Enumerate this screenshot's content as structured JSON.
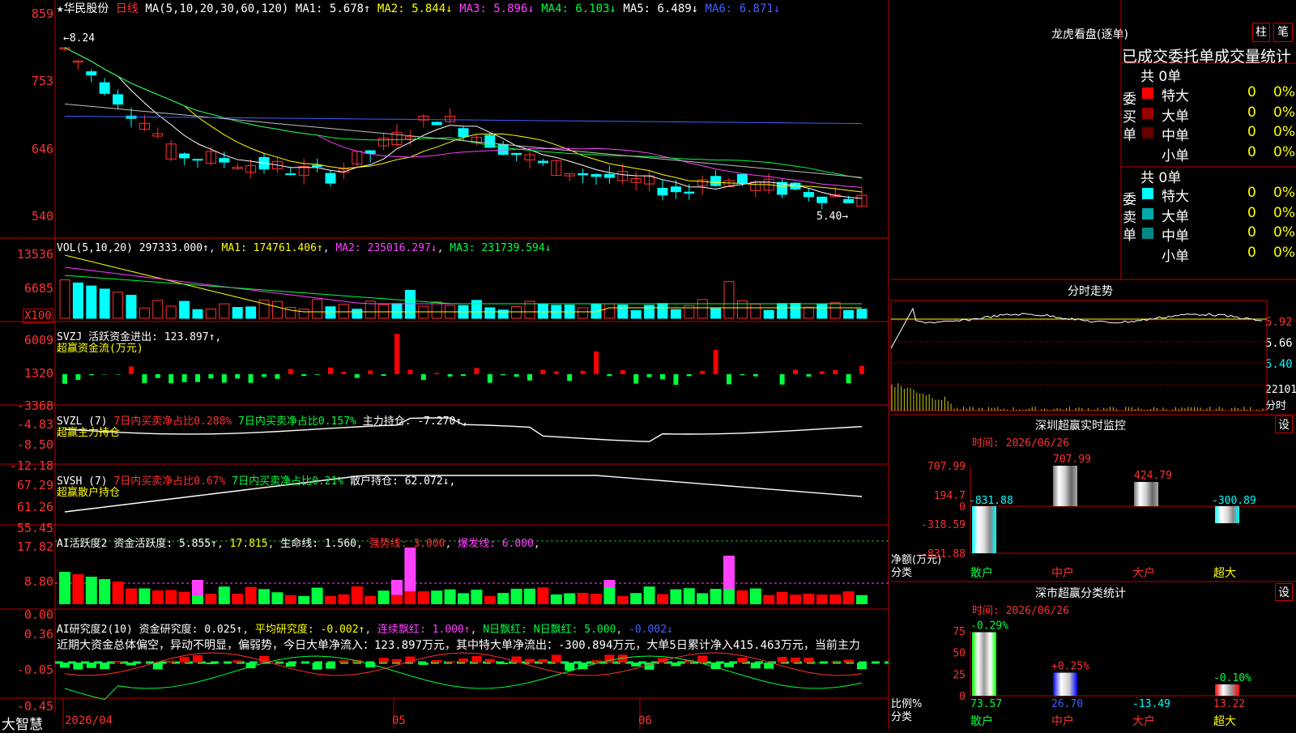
{
  "stock": {
    "name": "华民股份",
    "period": "日线",
    "ma_header": "MA(5,10,20,30,60,120)",
    "ma1": "MA1: 5.678↑",
    "ma2": "MA2: 5.844↓",
    "ma3": "MA3: 5.896↓",
    "ma4": "MA4: 6.103↓",
    "ma5": "MA5: 6.489↓",
    "ma6": "MA6: 6.871↓",
    "high_mark": "8.24",
    "low_mark": "5.40→",
    "y_ticks": [
      "859",
      "753",
      "646",
      "540"
    ]
  },
  "vol": {
    "header": "VOL(5,10,20)",
    "value": "297333.000↑",
    "ma1": "MA1: 174761.406↑",
    "ma2": "MA2: 235016.297↓",
    "ma3": "MA3: 231739.594↓",
    "y_ticks": [
      "13536",
      "6685"
    ],
    "unit": "X100"
  },
  "svzj": {
    "header": "SVZJ 活跃资金进出: 123.897↑,",
    "sub": "超赢资金流(万元)",
    "y_ticks": [
      "6009",
      "1320",
      "-3368"
    ]
  },
  "svzl": {
    "name": "SVZL (7)",
    "buy": "7日内买卖净占比0.288%",
    "buy2": "7日内买卖净占比0.157%",
    "pos": "主力持仓: -7.270↑,",
    "sub": "超赢主力持仓",
    "y_ticks": [
      "-4.83",
      "-8.50",
      "-12.18"
    ]
  },
  "svsh": {
    "name": "SVSH (7)",
    "buy": "7日内买卖净占比0.67%",
    "buy2": "7日内买卖净占比0.21%",
    "pos": "散户持仓: 62.072↓,",
    "sub": "超赢散户持仓",
    "y_ticks": [
      "67.29",
      "61.26",
      "55.45"
    ]
  },
  "ai1": {
    "name": "AI活跃度2",
    "a": "资金活跃度: 5.855↑",
    "b": "17.815",
    "c": "生命线: 1.560",
    "d": "强势线: 3.000",
    "e": "爆发线: 6.000",
    "y_ticks": [
      "17.82",
      "8.80",
      "0.00"
    ]
  },
  "ai2": {
    "name": "AI研究度2(10)",
    "a": "资金研究度: 0.025↑",
    "b": "平均研究度: -0.002↑",
    "c": "连续飘红: 1.000↑",
    "d": "N日飘红: 5.000",
    "e": "-0.002↓",
    "text": "近期大资金总体偏空，异动不明显，偏弱势，今日大单净流入：123.897万元，其中特大单净流出：-300.894万元，大单5日累计净入415.463万元，当前主力",
    "y_ticks": [
      "0.36",
      "-0.05",
      "-0.45"
    ]
  },
  "axis": {
    "d1": "2026/04",
    "d2": "05",
    "d3": "06",
    "brand": "大智慧"
  },
  "lhb": {
    "title": "龙虎看盘(逐单)",
    "btn1": "柱",
    "btn2": "笔",
    "subtitle": "已成交委托单成交量统计",
    "buy_label": "委买单",
    "sell_label": "委卖单",
    "buy_total": "共 0单",
    "sell_total": "共 0单",
    "rows": [
      {
        "name": "特大",
        "v": "0",
        "p": "0%",
        "color": "#ff0000"
      },
      {
        "name": "大单",
        "v": "0",
        "p": "0%",
        "color": "#990000"
      },
      {
        "name": "中单",
        "v": "0",
        "p": "0%",
        "color": "#660000"
      },
      {
        "name": "小单",
        "v": "0",
        "p": "0%",
        "color": ""
      }
    ],
    "srows": [
      {
        "name": "特大",
        "v": "0",
        "p": "0%",
        "color": "#00ffff"
      },
      {
        "name": "大单",
        "v": "0",
        "p": "0%",
        "color": "#00aaaa"
      },
      {
        "name": "中单",
        "v": "0",
        "p": "0%",
        "color": "#008888"
      },
      {
        "name": "小单",
        "v": "0",
        "p": "0%",
        "color": ""
      }
    ]
  },
  "intraday": {
    "title": "分时走势",
    "p1": "5.92",
    "p2": "5.66",
    "p3": "5.40",
    "vol": "22101",
    "unit": "分时"
  },
  "sz_monitor": {
    "title": "深圳超赢实时监控",
    "btn": "设",
    "time": "时间: 2026/06/26",
    "y_ticks": [
      "707.99",
      "194.7",
      "0",
      "-318.59",
      "-831.88"
    ],
    "ylabel": "净额(万元)",
    "xlabel": "分类",
    "categories": [
      "散户",
      "中户",
      "大户",
      "超大"
    ],
    "values": [
      -831.88,
      707.99,
      424.79,
      -300.89
    ],
    "labels": [
      "-831.88",
      "707.99",
      "424.79",
      "-300.89"
    ]
  },
  "sz_class": {
    "title": "深市超赢分类统计",
    "btn": "设",
    "time": "时间: 2026/06/26",
    "y_ticks": [
      "75",
      "50",
      "25",
      "0"
    ],
    "ylabel": "比例%",
    "xlabel": "分类",
    "categories": [
      "散户",
      "中户",
      "大户",
      "超大"
    ],
    "values": [
      73.57,
      26.7,
      -13.49,
      13.22
    ],
    "labels": [
      "73.57",
      "26.70",
      "-13.49",
      "13.22"
    ],
    "pct": [
      "-0.29%",
      "+0.25%",
      "",
      "-0.10%"
    ]
  },
  "chart_data": [
    {
      "type": "candlestick",
      "title": "华民股份 日线",
      "ylim": [
        5.2,
        8.6
      ],
      "x": [
        "2026/04",
        "05",
        "06"
      ],
      "series": [
        {
          "name": "MA1"
        },
        {
          "name": "MA2"
        },
        {
          "name": "MA3"
        },
        {
          "name": "MA4"
        },
        {
          "name": "MA5"
        },
        {
          "name": "MA6"
        }
      ],
      "highest": 8.24,
      "lowest": 5.4
    },
    {
      "type": "bar",
      "title": "深圳超赢实时监控",
      "categories": [
        "散户",
        "中户",
        "大户",
        "超大"
      ],
      "values": [
        -831.88,
        707.99,
        424.79,
        -300.89
      ],
      "ylabel": "净额(万元)"
    },
    {
      "type": "bar",
      "title": "深市超赢分类统计",
      "categories": [
        "散户",
        "中户",
        "大户",
        "超大"
      ],
      "values": [
        73.57,
        26.7,
        -13.49,
        13.22
      ],
      "ylabel": "比例%"
    }
  ]
}
